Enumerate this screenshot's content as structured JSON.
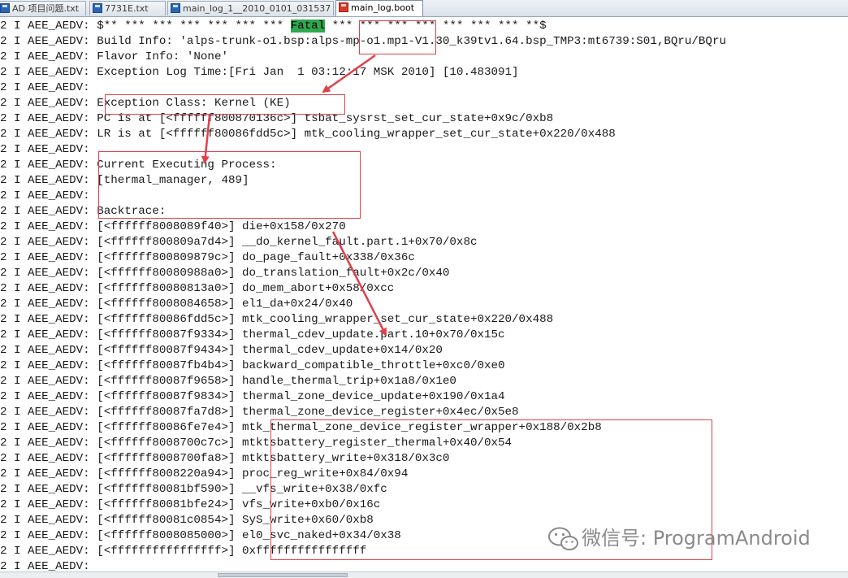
{
  "tabs": [
    {
      "label": "AD 项目问题.txt",
      "icon": "text-file-icon",
      "active": false
    },
    {
      "label": "7731E.txt",
      "icon": "text-file-icon",
      "active": false
    },
    {
      "label": "main_log_1__2010_0101_031537",
      "icon": "text-file-icon",
      "active": false
    },
    {
      "label": "main_log.boot",
      "icon": "text-file-icon",
      "active": true
    }
  ],
  "log_lines": [
    {
      "prefix": "2 I AEE_AEDV: ",
      "pre": "$** *** *** *** *** *** *** ",
      "hl": "Fatal",
      "post": " *** *** *** *** *** *** *** **$"
    },
    {
      "prefix": "2 I AEE_AEDV: ",
      "pre": "Build Info: 'alps-trunk-o1.bsp:alps-mp-o1.mp1-V1.30_k39tv1.64.bsp_TMP3:mt6739:S01,BQru/BQru"
    },
    {
      "prefix": "2 I AEE_AEDV: ",
      "pre": "Flavor Info: 'None'"
    },
    {
      "prefix": "2 I AEE_AEDV: ",
      "pre": "Exception Log Time:[Fri Jan  1 03:12:17 MSK 2010] [10.483091]"
    },
    {
      "prefix": "2 I AEE_AEDV: ",
      "pre": ""
    },
    {
      "prefix": "2 I AEE_AEDV: ",
      "pre": "Exception Class: Kernel (KE)"
    },
    {
      "prefix": "2 I AEE_AEDV: ",
      "pre": "PC is at [<ffffff800870136c>] tsbat_sysrst_set_cur_state+0x9c/0xb8"
    },
    {
      "prefix": "2 I AEE_AEDV: ",
      "pre": "LR is at [<ffffff80086fdd5c>] mtk_cooling_wrapper_set_cur_state+0x220/0x488"
    },
    {
      "prefix": "2 I AEE_AEDV: ",
      "pre": ""
    },
    {
      "prefix": "2 I AEE_AEDV: ",
      "pre": "Current Executing Process:"
    },
    {
      "prefix": "2 I AEE_AEDV: ",
      "pre": "[thermal_manager, 489]"
    },
    {
      "prefix": "2 I AEE_AEDV: ",
      "pre": ""
    },
    {
      "prefix": "2 I AEE_AEDV: ",
      "pre": "Backtrace:"
    },
    {
      "prefix": "2 I AEE_AEDV: ",
      "pre": "[<ffffff8008089f40>] die+0x158/0x270"
    },
    {
      "prefix": "2 I AEE_AEDV: ",
      "pre": "[<ffffff800809a7d4>] __do_kernel_fault.part.1+0x70/0x8c"
    },
    {
      "prefix": "2 I AEE_AEDV: ",
      "pre": "[<ffffff800809879c>] do_page_fault+0x338/0x36c"
    },
    {
      "prefix": "2 I AEE_AEDV: ",
      "pre": "[<ffffff80080988a0>] do_translation_fault+0x2c/0x40"
    },
    {
      "prefix": "2 I AEE_AEDV: ",
      "pre": "[<ffffff80080813a0>] do_mem_abort+0x58/0xcc"
    },
    {
      "prefix": "2 I AEE_AEDV: ",
      "pre": "[<ffffff8008084658>] el1_da+0x24/0x40"
    },
    {
      "prefix": "2 I AEE_AEDV: ",
      "pre": "[<ffffff80086fdd5c>] mtk_cooling_wrapper_set_cur_state+0x220/0x488"
    },
    {
      "prefix": "2 I AEE_AEDV: ",
      "pre": "[<ffffff80087f9334>] thermal_cdev_update.part.10+0x70/0x15c"
    },
    {
      "prefix": "2 I AEE_AEDV: ",
      "pre": "[<ffffff80087f9434>] thermal_cdev_update+0x14/0x20"
    },
    {
      "prefix": "2 I AEE_AEDV: ",
      "pre": "[<ffffff80087fb4b4>] backward_compatible_throttle+0xc0/0xe0"
    },
    {
      "prefix": "2 I AEE_AEDV: ",
      "pre": "[<ffffff80087f9658>] handle_thermal_trip+0x1a8/0x1e0"
    },
    {
      "prefix": "2 I AEE_AEDV: ",
      "pre": "[<ffffff80087f9834>] thermal_zone_device_update+0x190/0x1a4"
    },
    {
      "prefix": "2 I AEE_AEDV: ",
      "pre": "[<ffffff80087fa7d8>] thermal_zone_device_register+0x4ec/0x5e8"
    },
    {
      "prefix": "2 I AEE_AEDV: ",
      "pre": "[<ffffff80086fe7e4>] mtk_thermal_zone_device_register_wrapper+0x188/0x2b8"
    },
    {
      "prefix": "2 I AEE_AEDV: ",
      "pre": "[<ffffff8008700c7c>] mtktsbattery_register_thermal+0x40/0x54"
    },
    {
      "prefix": "2 I AEE_AEDV: ",
      "pre": "[<ffffff8008700fa8>] mtktsbattery_write+0x318/0x3c0"
    },
    {
      "prefix": "2 I AEE_AEDV: ",
      "pre": "[<ffffff8008220a94>] proc_reg_write+0x84/0x94"
    },
    {
      "prefix": "2 I AEE_AEDV: ",
      "pre": "[<ffffff80081bf590>] __vfs_write+0x38/0xfc"
    },
    {
      "prefix": "2 I AEE_AEDV: ",
      "pre": "[<ffffff80081bfe24>] vfs_write+0xb0/0x16c"
    },
    {
      "prefix": "2 I AEE_AEDV: ",
      "pre": "[<ffffff80081c0854>] SyS_write+0x60/0xb8"
    },
    {
      "prefix": "2 I AEE_AEDV: ",
      "pre": "[<ffffff8008085000>] el0_svc_naked+0x34/0x38"
    },
    {
      "prefix": "2 I AEE_AEDV: ",
      "pre": "[<ffffffffffffffff>] 0xffffffffffffffff"
    },
    {
      "prefix": "2 I AEE_AEDV: ",
      "pre": ""
    }
  ],
  "watermark": {
    "text": "微信号: ProgramAndroid",
    "icon": "wechat-icon"
  },
  "colors": {
    "annotation": "#e0404a",
    "highlight": "#2fa84f"
  }
}
